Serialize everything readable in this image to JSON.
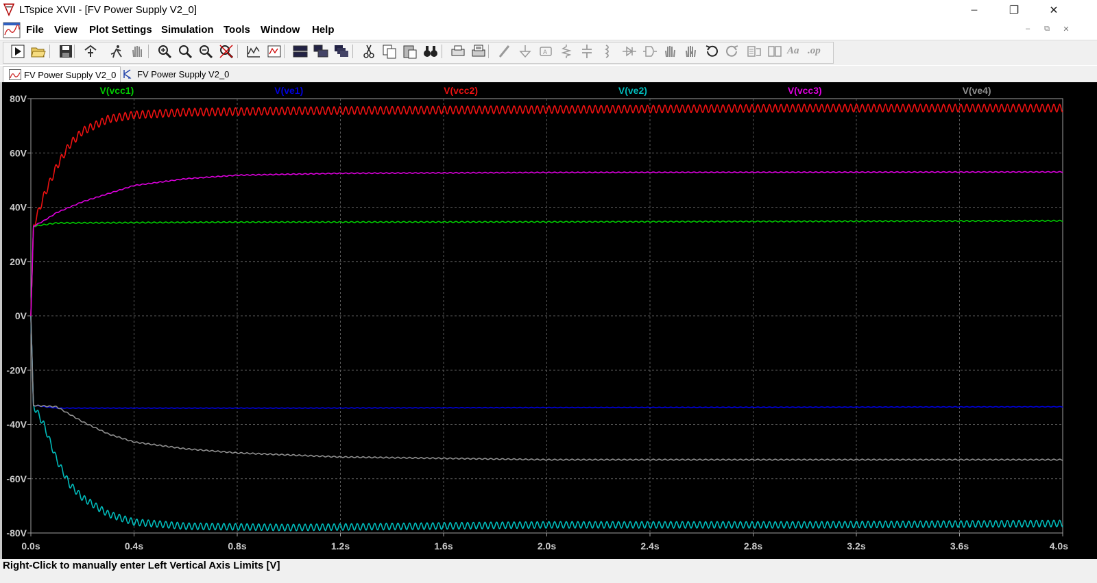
{
  "window": {
    "title": "LTspice XVII - [FV Power Supply V2_0]",
    "minimize": "–",
    "restore": "❐",
    "close": "✕"
  },
  "menu": {
    "items": [
      "File",
      "View",
      "Plot Settings",
      "Simulation",
      "Tools",
      "Window",
      "Help"
    ],
    "mdi": [
      "–",
      "⧉",
      "✕"
    ]
  },
  "toolbar": {
    "icons": [
      "run-icon",
      "open-icon",
      "save-icon",
      "control-panel-icon",
      "halt-icon",
      "pan-icon",
      "zoom-area-icon",
      "zoom-in-icon",
      "zoom-out-icon",
      "zoom-cancel-icon",
      "autorange-icon",
      "add-plot-pane-icon",
      "tile-horizontal-icon",
      "tile-vertical-icon",
      "cascade-icon",
      "cut-icon",
      "copy-icon",
      "paste-icon",
      "find-icon",
      "print-icon",
      "print-setup-icon",
      "wire-icon",
      "ground-icon",
      "label-net-icon",
      "resistor-icon",
      "capacitor-icon",
      "inductor-icon",
      "diode-icon",
      "component-icon",
      "move-icon",
      "drag-icon",
      "undo-icon",
      "redo-icon",
      "rotate-icon",
      "mirror-icon",
      "text-icon",
      "spice-directive-icon"
    ],
    "text_icons": {
      "text-icon": "Aa",
      "spice-directive-icon": ".op"
    }
  },
  "tabs": [
    {
      "label": "FV Power Supply V2_0",
      "kind": "waveform",
      "active": true
    },
    {
      "label": "FV Power Supply V2_0",
      "kind": "schematic",
      "active": false
    }
  ],
  "status": {
    "text": "Right-Click to manually enter Left Vertical Axis Limits [V]"
  },
  "colors": {
    "plot_bg": "#000000",
    "grid": "#5a5a5a",
    "axis": "#a0a0a0",
    "tick_text": "#cccccc"
  },
  "chart_data": {
    "type": "line",
    "title": "",
    "xlabel": "",
    "ylabel": "",
    "xlim": [
      0,
      4.0
    ],
    "ylim": [
      -80,
      80
    ],
    "x_ticks": [
      0,
      0.4,
      0.8,
      1.2,
      1.6,
      2.0,
      2.4,
      2.8,
      3.2,
      3.6,
      4.0
    ],
    "x_tick_labels": [
      "0.0s",
      "0.4s",
      "0.8s",
      "1.2s",
      "1.6s",
      "2.0s",
      "2.4s",
      "2.8s",
      "3.2s",
      "3.6s",
      "4.0s"
    ],
    "y_ticks": [
      80,
      60,
      40,
      20,
      0,
      -20,
      -40,
      -60,
      -80
    ],
    "y_tick_labels": [
      "80V",
      "60V",
      "40V",
      "20V",
      "0V",
      "-20V",
      "-40V",
      "-60V",
      "-80V"
    ],
    "grid": true,
    "legend": "top",
    "series": [
      {
        "name": "V(vcc1)",
        "color": "#00cc00",
        "ripple": 0.2,
        "points": [
          [
            0,
            0
          ],
          [
            0.01,
            33
          ],
          [
            0.1,
            34.2
          ],
          [
            0.8,
            34.5
          ],
          [
            2.0,
            34.6
          ],
          [
            4.0,
            35
          ]
        ]
      },
      {
        "name": "V(ve1)",
        "color": "#0000dd",
        "ripple": 0.1,
        "points": [
          [
            0,
            0
          ],
          [
            0.01,
            -33
          ],
          [
            0.1,
            -34
          ],
          [
            1.0,
            -34
          ],
          [
            2.0,
            -33.8
          ],
          [
            4.0,
            -33.5
          ]
        ]
      },
      {
        "name": "V(vcc2)",
        "color": "#ee1111",
        "ripple": 1.4,
        "points": [
          [
            0,
            0
          ],
          [
            0.01,
            33
          ],
          [
            0.05,
            44
          ],
          [
            0.1,
            55
          ],
          [
            0.15,
            63
          ],
          [
            0.2,
            68
          ],
          [
            0.3,
            72.5
          ],
          [
            0.4,
            74
          ],
          [
            0.6,
            75
          ],
          [
            1.0,
            75.5
          ],
          [
            2.0,
            76
          ],
          [
            3.0,
            76.5
          ],
          [
            4.0,
            76.5
          ]
        ]
      },
      {
        "name": "V(ve2)",
        "color": "#00bbbb",
        "ripple": 1.2,
        "points": [
          [
            0,
            0
          ],
          [
            0.01,
            -33
          ],
          [
            0.05,
            -40
          ],
          [
            0.1,
            -53
          ],
          [
            0.15,
            -62
          ],
          [
            0.2,
            -67
          ],
          [
            0.3,
            -73
          ],
          [
            0.4,
            -76
          ],
          [
            0.6,
            -77.5
          ],
          [
            1.0,
            -78
          ],
          [
            2.0,
            -77
          ],
          [
            3.0,
            -77
          ],
          [
            4.0,
            -76.5
          ]
        ]
      },
      {
        "name": "V(vcc3)",
        "color": "#dd00dd",
        "ripple": 0.15,
        "points": [
          [
            0,
            0
          ],
          [
            0.01,
            33
          ],
          [
            0.05,
            35
          ],
          [
            0.1,
            38
          ],
          [
            0.2,
            42
          ],
          [
            0.3,
            45
          ],
          [
            0.4,
            48
          ],
          [
            0.6,
            50.5
          ],
          [
            0.8,
            51.8
          ],
          [
            1.2,
            52.5
          ],
          [
            2.0,
            52.8
          ],
          [
            4.0,
            53
          ]
        ]
      },
      {
        "name": "V(ve4)",
        "color": "#909090",
        "ripple": 0.2,
        "points": [
          [
            0,
            0
          ],
          [
            0.01,
            -33
          ],
          [
            0.1,
            -33.5
          ],
          [
            0.2,
            -39
          ],
          [
            0.3,
            -43.5
          ],
          [
            0.4,
            -46.5
          ],
          [
            0.6,
            -49
          ],
          [
            0.8,
            -50.5
          ],
          [
            1.2,
            -52
          ],
          [
            1.6,
            -52.5
          ],
          [
            2.0,
            -53
          ],
          [
            4.0,
            -53
          ]
        ]
      }
    ]
  }
}
